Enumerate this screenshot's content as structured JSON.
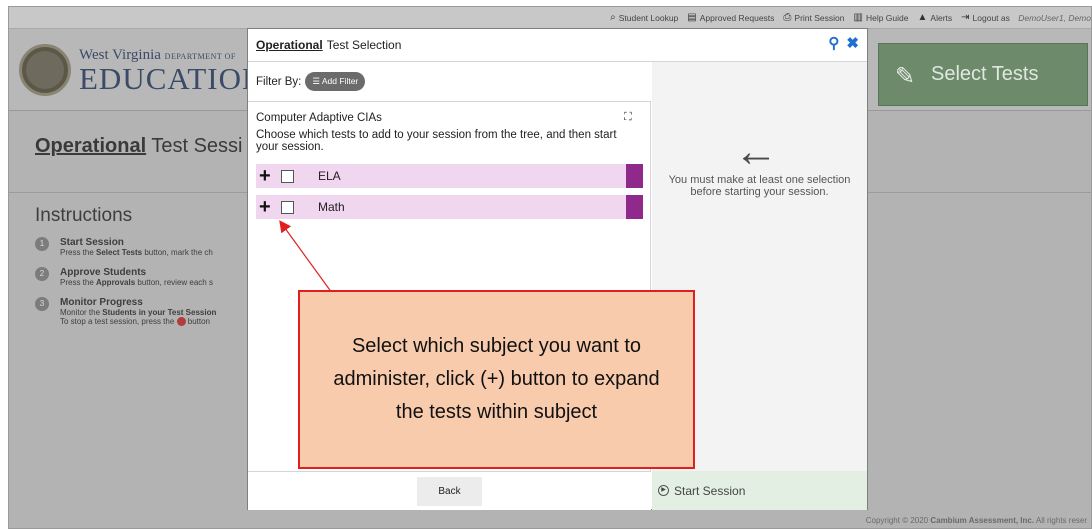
{
  "topbar": {
    "links": [
      {
        "icon": "search-icon",
        "label": "Student Lookup"
      },
      {
        "icon": "document-icon",
        "label": "Approved Requests"
      },
      {
        "icon": "printer-icon",
        "label": "Print Session"
      },
      {
        "icon": "book-icon",
        "label": "Help Guide"
      },
      {
        "icon": "warning-icon",
        "label": "Alerts"
      },
      {
        "icon": "logout-icon",
        "label": "Logout as"
      }
    ],
    "user": "DemoUser1, Demo"
  },
  "logo": {
    "line1": "West Virginia",
    "line1_small": "DEPARTMENT OF",
    "line2": "EDUCATION"
  },
  "header": {
    "select_tests": "Select Tests"
  },
  "session": {
    "prefix": "Operational",
    "title": "Test Sessi"
  },
  "instructions": {
    "heading": "Instructions",
    "steps": [
      {
        "num": "1",
        "title": "Start Session",
        "pre": "Press the ",
        "bold": "Select Tests",
        "post": " button, mark the ch"
      },
      {
        "num": "2",
        "title": "Approve Students",
        "pre": "Press the ",
        "bold": "Approvals",
        "post": " button, review each s"
      },
      {
        "num": "3",
        "title": "Monitor Progress",
        "pre": "Monitor the ",
        "bold": "Students in your Test Session",
        "post": "",
        "line2": "To stop a test session, press the",
        "line2_post": " button"
      }
    ]
  },
  "modal": {
    "title_prefix": "Operational",
    "title": "Test Selection",
    "filter_label": "Filter By:",
    "add_filter": "Add Filter",
    "pane_title": "Computer Adaptive CIAs",
    "pane_desc": "Choose which tests to add to your session from the tree, and then start your session.",
    "subjects": [
      {
        "name": "ELA"
      },
      {
        "name": "Math"
      }
    ],
    "must_select": "You must make at least one selection before starting your session.",
    "back": "Back",
    "start": "Start Session"
  },
  "callout": {
    "text": "Select which subject you want to administer, click (+) button to expand the tests within subject"
  },
  "copyright": {
    "pre": "Copyright © 2020 ",
    "bold": "Cambium Assessment, Inc.",
    "post": " All rights reser"
  },
  "colors": {
    "subject_row": "#f1d6f0",
    "subject_bar": "#8f2a8c",
    "callout_fill": "#f8cbad",
    "callout_border": "#e02020",
    "accent": "#1e6fcf"
  }
}
